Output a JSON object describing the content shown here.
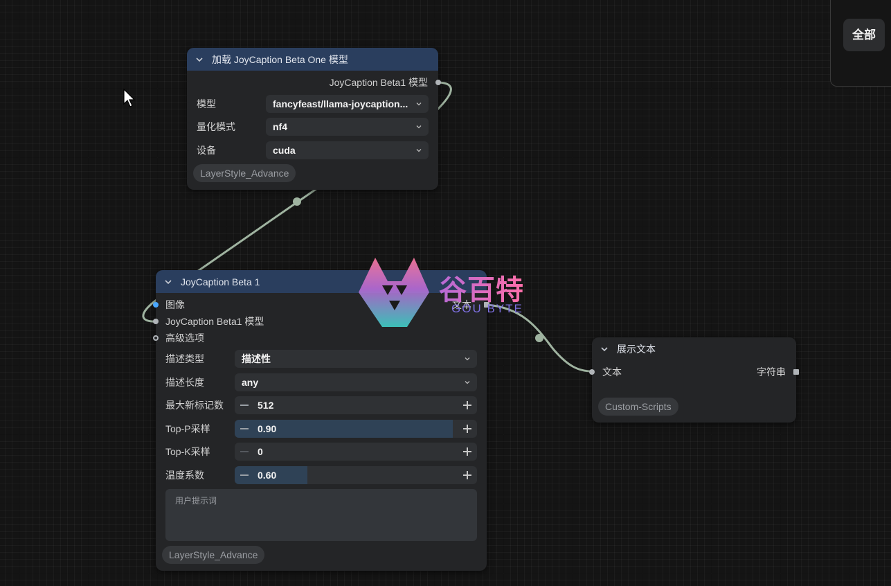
{
  "top_right": {
    "all_button": "全部"
  },
  "load_node": {
    "title": "加载 JoyCaption Beta One 模型",
    "output_label": "JoyCaption Beta1 模型",
    "fields": [
      {
        "label": "模型",
        "value": "fancyfeast/llama-joycaption..."
      },
      {
        "label": "量化模式",
        "value": "nf4"
      },
      {
        "label": "设备",
        "value": "cuda"
      }
    ],
    "badge": "LayerStyle_Advance"
  },
  "caption_node": {
    "title": "JoyCaption Beta 1",
    "inputs": [
      "图像",
      "JoyCaption Beta1 模型",
      "高级选项"
    ],
    "output_label": "文本",
    "combos": [
      {
        "label": "描述类型",
        "value": "描述性"
      },
      {
        "label": "描述长度",
        "value": "any"
      }
    ],
    "numbers": [
      {
        "label": "最大新标记数",
        "value": "512",
        "fill_fraction": 0.0
      },
      {
        "label": "Top-P采样",
        "value": "0.90",
        "fill_fraction": 0.9
      },
      {
        "label": "Top-K采样",
        "value": "0",
        "fill_fraction": 0.0
      },
      {
        "label": "温度系数",
        "value": "0.60",
        "fill_fraction": 0.3
      }
    ],
    "prompt_placeholder": "用户提示词",
    "badge": "LayerStyle_Advance"
  },
  "show_node": {
    "title": "展示文本",
    "input_label": "文本",
    "output_label": "字符串",
    "badge": "Custom-Scripts"
  },
  "watermark": {
    "chinese": "谷百特",
    "english": "GOU BYTE"
  },
  "colors": {
    "node_header": "#2a3e5e",
    "node_body": "#242527",
    "wire": "#9fb3a0",
    "image_socket": "#4aa8ff",
    "number_fill": "#2f4256"
  }
}
